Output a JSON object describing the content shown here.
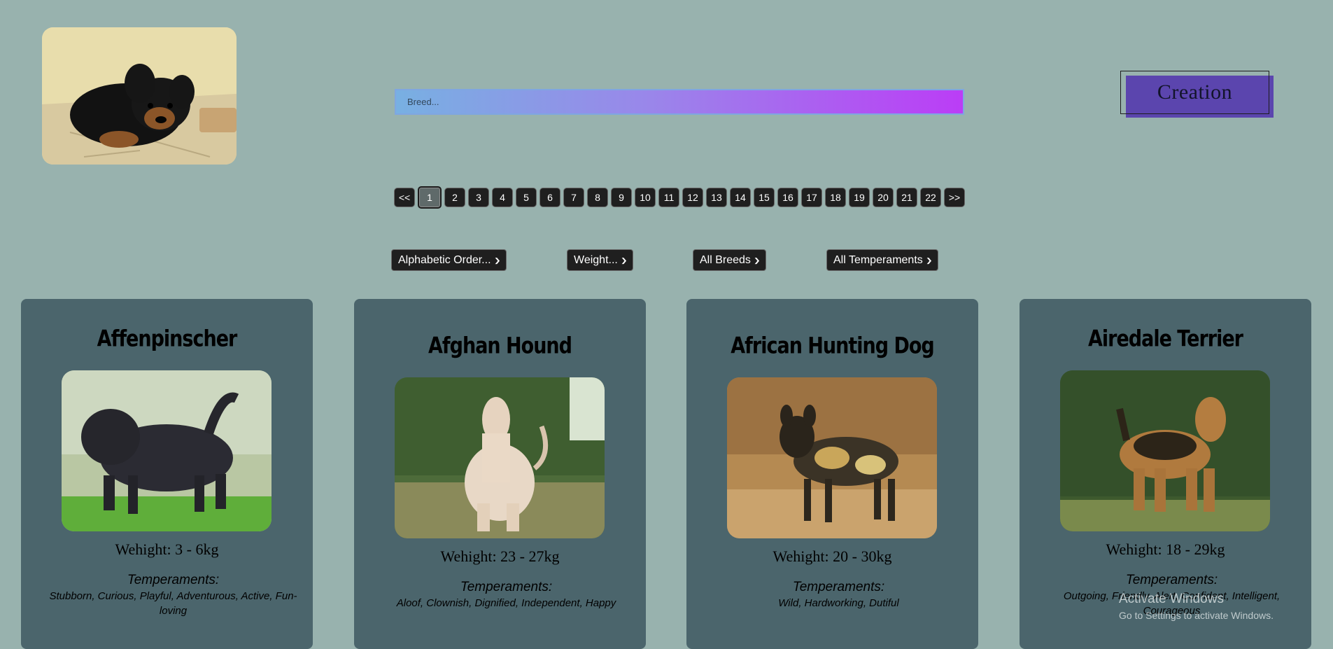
{
  "logo": {
    "alt": "Puppy"
  },
  "search": {
    "placeholder": "Breed..."
  },
  "creation": {
    "label": "Creation"
  },
  "pagination": {
    "prev": "<<",
    "next": ">>",
    "pages": [
      "1",
      "2",
      "3",
      "4",
      "5",
      "6",
      "7",
      "8",
      "9",
      "10",
      "11",
      "12",
      "13",
      "14",
      "15",
      "16",
      "17",
      "18",
      "19",
      "20",
      "21",
      "22"
    ],
    "current": "1"
  },
  "filters": {
    "order": "Alphabetic Order...",
    "weight": "Weight...",
    "breeds": "All Breeds",
    "temperaments": "All Temperaments"
  },
  "cards": [
    {
      "name": "Affenpinscher",
      "weight": "Wehight: 3 - 6kg",
      "temperaments_label": "Temperaments:",
      "temperaments": "Stubborn, Curious, Playful, Adventurous, Active, Fun-loving"
    },
    {
      "name": "Afghan Hound",
      "weight": "Wehight: 23 - 27kg",
      "temperaments_label": "Temperaments:",
      "temperaments": "Aloof, Clownish, Dignified, Independent, Happy"
    },
    {
      "name": "African Hunting Dog",
      "weight": "Wehight: 20 - 30kg",
      "temperaments_label": "Temperaments:",
      "temperaments": "Wild, Hardworking, Dutiful"
    },
    {
      "name": "Airedale Terrier",
      "weight": "Wehight: 18 - 29kg",
      "temperaments_label": "Temperaments:",
      "temperaments": "Outgoing, Friendly, Alert, Confident, Intelligent, Courageous"
    }
  ],
  "watermark": {
    "title": "Activate Windows",
    "subtitle": "Go to Settings to activate Windows."
  },
  "colors": {
    "background": "#98b2ae",
    "card": "#4b656c",
    "creation_accent": "#5b45ae",
    "search_gradient_start": "#78b0e2",
    "search_gradient_end": "#bb3df6",
    "button_dark": "#1f1f1f"
  }
}
